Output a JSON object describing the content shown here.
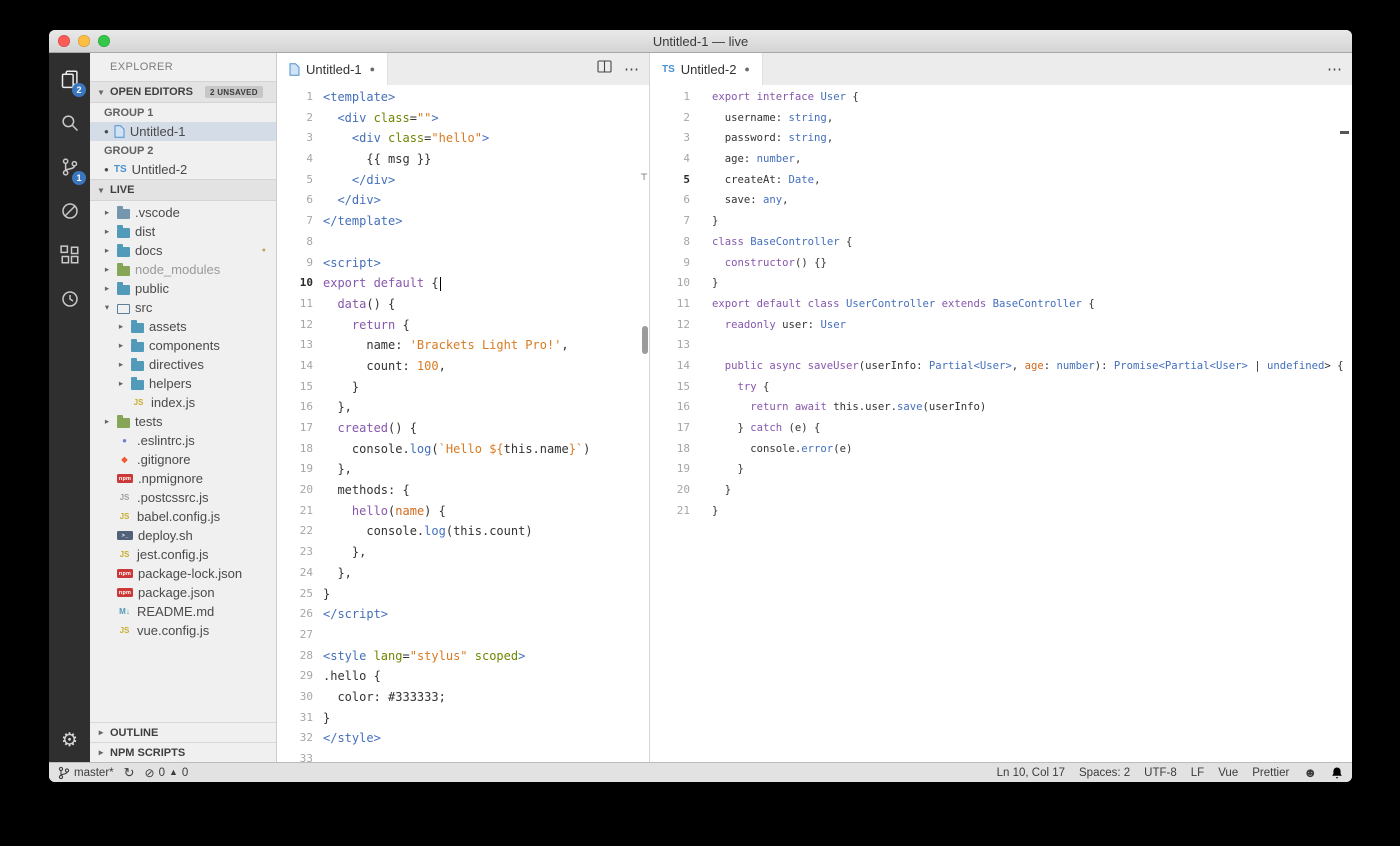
{
  "window": {
    "title": "Untitled-1 — live"
  },
  "colors": {
    "keyword": "#8757ad",
    "type": "#446fbd",
    "string": "#d97a20",
    "number": "#d97a20",
    "attribute": "#6d8600",
    "function": "#8757ad",
    "parameter": "#d2691e",
    "text": "#333333",
    "badge_blue": "#3b76c1",
    "tab_dirty": "#6a6a6a"
  },
  "activity_bar": {
    "explorer_badge": "2",
    "scm_badge": "1"
  },
  "sidebar": {
    "title": "EXPLORER",
    "open_editors": {
      "label": "OPEN EDITORS",
      "badge": "2 UNSAVED",
      "groups": [
        {
          "label": "GROUP 1",
          "files": [
            {
              "name": "Untitled-1"
            }
          ]
        },
        {
          "label": "GROUP 2",
          "files": [
            {
              "name": "Untitled-2",
              "icon_text": "TS"
            }
          ]
        }
      ]
    },
    "project_label": "LIVE",
    "tree": [
      {
        "label": ".vscode",
        "depth": 1,
        "chevron": "closed",
        "icon": {
          "kind": "folder",
          "color": "#7596ad",
          "name": "folder-icon"
        }
      },
      {
        "label": "dist",
        "depth": 1,
        "chevron": "closed",
        "icon": {
          "kind": "folder",
          "color": "#519aba",
          "name": "folder-icon"
        }
      },
      {
        "label": "docs",
        "depth": 1,
        "chevron": "closed",
        "dot": "#c5a05c",
        "icon": {
          "kind": "folder",
          "color": "#519aba",
          "name": "folder-icon"
        }
      },
      {
        "label": "node_modules",
        "depth": 1,
        "chevron": "closed",
        "muted": true,
        "icon": {
          "kind": "folder",
          "color": "#87a556",
          "name": "folder-icon"
        }
      },
      {
        "label": "public",
        "depth": 1,
        "chevron": "closed",
        "icon": {
          "kind": "folder",
          "color": "#519aba",
          "name": "folder-icon"
        }
      },
      {
        "label": "src",
        "depth": 1,
        "chevron": "open",
        "icon": {
          "kind": "folder-open",
          "color": "#5b7e9b",
          "name": "folder-open-icon"
        }
      },
      {
        "label": "assets",
        "depth": 2,
        "chevron": "closed",
        "icon": {
          "kind": "folder",
          "color": "#519aba",
          "name": "folder-icon"
        }
      },
      {
        "label": "components",
        "depth": 2,
        "chevron": "closed",
        "icon": {
          "kind": "folder",
          "color": "#519aba",
          "name": "folder-icon"
        }
      },
      {
        "label": "directives",
        "depth": 2,
        "chevron": "closed",
        "icon": {
          "kind": "folder",
          "color": "#519aba",
          "name": "folder-icon"
        }
      },
      {
        "label": "helpers",
        "depth": 2,
        "chevron": "closed",
        "icon": {
          "kind": "folder",
          "color": "#519aba",
          "name": "folder-icon"
        }
      },
      {
        "label": "index.js",
        "depth": 2,
        "icon": {
          "kind": "glyph",
          "text": "JS",
          "color": "#c9ac2e",
          "name": "js-icon"
        }
      },
      {
        "label": "tests",
        "depth": 1,
        "chevron": "closed",
        "icon": {
          "kind": "folder",
          "color": "#87a556",
          "name": "folder-icon"
        }
      },
      {
        "label": ".eslintrc.js",
        "depth": 1,
        "icon": {
          "kind": "glyph",
          "text": "●",
          "color": "#6f7ccf",
          "name": "eslint-icon"
        }
      },
      {
        "label": ".gitignore",
        "depth": 1,
        "icon": {
          "kind": "glyph",
          "text": "◆",
          "color": "#ee5b32",
          "name": "git-icon"
        }
      },
      {
        "label": ".npmignore",
        "depth": 1,
        "icon": {
          "kind": "pill",
          "text": "npm",
          "color": "#cb3837",
          "name": "npm-icon"
        }
      },
      {
        "label": ".postcssrc.js",
        "depth": 1,
        "icon": {
          "kind": "glyph",
          "text": "JS",
          "color": "#a0a0a0",
          "name": "postcss-icon"
        }
      },
      {
        "label": "babel.config.js",
        "depth": 1,
        "icon": {
          "kind": "glyph",
          "text": "JS",
          "color": "#c9ac2e",
          "name": "js-icon"
        }
      },
      {
        "label": "deploy.sh",
        "depth": 1,
        "icon": {
          "kind": "pill",
          "text": ">_",
          "color": "#51617a",
          "name": "shell-icon"
        }
      },
      {
        "label": "jest.config.js",
        "depth": 1,
        "icon": {
          "kind": "glyph",
          "text": "JS",
          "color": "#c9ac2e",
          "name": "js-icon"
        }
      },
      {
        "label": "package-lock.json",
        "depth": 1,
        "icon": {
          "kind": "pill",
          "text": "npm",
          "color": "#cb3837",
          "name": "npm-icon"
        }
      },
      {
        "label": "package.json",
        "depth": 1,
        "icon": {
          "kind": "pill",
          "text": "npm",
          "color": "#cb3837",
          "name": "npm-icon"
        }
      },
      {
        "label": "README.md",
        "depth": 1,
        "icon": {
          "kind": "glyph",
          "text": "M↓",
          "color": "#519aba",
          "name": "markdown-icon"
        }
      },
      {
        "label": "vue.config.js",
        "depth": 1,
        "icon": {
          "kind": "glyph",
          "text": "JS",
          "color": "#c9ac2e",
          "name": "js-icon"
        }
      }
    ],
    "bottom_sections": [
      "OUTLINE",
      "NPM SCRIPTS"
    ]
  },
  "editors": [
    {
      "tab": {
        "label": "Untitled-1"
      },
      "active_line": 10,
      "cursor": 10,
      "lines": [
        [
          [
            "t",
            "<template>"
          ]
        ],
        [
          [
            "d",
            "  "
          ],
          [
            "t",
            "<div "
          ],
          [
            "a",
            "class"
          ],
          [
            "d",
            "="
          ],
          [
            "s",
            "\"\""
          ],
          [
            "t",
            ">"
          ]
        ],
        [
          [
            "d",
            "    "
          ],
          [
            "t",
            "<div "
          ],
          [
            "a",
            "class"
          ],
          [
            "d",
            "="
          ],
          [
            "s",
            "\"hello\""
          ],
          [
            "t",
            ">"
          ]
        ],
        [
          [
            "d",
            "      {{ msg }}"
          ]
        ],
        [
          [
            "d",
            "    "
          ],
          [
            "t",
            "</div>"
          ]
        ],
        [
          [
            "d",
            "  "
          ],
          [
            "t",
            "</div>"
          ]
        ],
        [
          [
            "t",
            "</template>"
          ]
        ],
        [],
        [
          [
            "t",
            "<script>"
          ]
        ],
        [
          [
            "k",
            "export default"
          ],
          [
            "d",
            " {"
          ]
        ],
        [
          [
            "d",
            "  "
          ],
          [
            "f",
            "data"
          ],
          [
            "d",
            "() {"
          ]
        ],
        [
          [
            "d",
            "    "
          ],
          [
            "k",
            "return"
          ],
          [
            "d",
            " {"
          ]
        ],
        [
          [
            "d",
            "      name: "
          ],
          [
            "s",
            "'Brackets Light Pro!'"
          ],
          [
            "d",
            ","
          ]
        ],
        [
          [
            "d",
            "      count: "
          ],
          [
            "n",
            "100"
          ],
          [
            "d",
            ","
          ]
        ],
        [
          [
            "d",
            "    }"
          ]
        ],
        [
          [
            "d",
            "  },"
          ]
        ],
        [
          [
            "d",
            "  "
          ],
          [
            "f",
            "created"
          ],
          [
            "d",
            "() {"
          ]
        ],
        [
          [
            "d",
            "    console."
          ],
          [
            "t",
            "log"
          ],
          [
            "d",
            "("
          ],
          [
            "s",
            "`Hello ${"
          ],
          [
            "d",
            "this.name"
          ],
          [
            "s",
            "}`"
          ],
          [
            "d",
            ")"
          ]
        ],
        [
          [
            "d",
            "  },"
          ]
        ],
        [
          [
            "d",
            "  methods: {"
          ]
        ],
        [
          [
            "d",
            "    "
          ],
          [
            "f",
            "hello"
          ],
          [
            "d",
            "("
          ],
          [
            "o",
            "name"
          ],
          [
            "d",
            ") {"
          ]
        ],
        [
          [
            "d",
            "      console."
          ],
          [
            "t",
            "log"
          ],
          [
            "d",
            "(this.count)"
          ]
        ],
        [
          [
            "d",
            "    },"
          ]
        ],
        [
          [
            "d",
            "  },"
          ]
        ],
        [
          [
            "d",
            "}"
          ]
        ],
        [
          [
            "t",
            "</script>"
          ]
        ],
        [],
        [
          [
            "t",
            "<style "
          ],
          [
            "a",
            "lang"
          ],
          [
            "d",
            "="
          ],
          [
            "s",
            "\"stylus\""
          ],
          [
            "d",
            " "
          ],
          [
            "a",
            "scoped"
          ],
          [
            "t",
            ">"
          ]
        ],
        [
          [
            "d",
            ".hello {"
          ]
        ],
        [
          [
            "d",
            "  color: #333333;"
          ]
        ],
        [
          [
            "d",
            "}"
          ]
        ],
        [
          [
            "t",
            "</style>"
          ]
        ],
        []
      ]
    },
    {
      "tab": {
        "label": "Untitled-2",
        "icon_text": "TS"
      },
      "active_line": 5,
      "lines": [
        [
          [
            "k",
            "export interface "
          ],
          [
            "t",
            "User"
          ],
          [
            "d",
            " {"
          ]
        ],
        [
          [
            "d",
            "  username: "
          ],
          [
            "t",
            "string"
          ],
          [
            "d",
            ","
          ]
        ],
        [
          [
            "d",
            "  password: "
          ],
          [
            "t",
            "string"
          ],
          [
            "d",
            ","
          ]
        ],
        [
          [
            "d",
            "  age: "
          ],
          [
            "t",
            "number"
          ],
          [
            "d",
            ","
          ]
        ],
        [
          [
            "d",
            "  createAt: "
          ],
          [
            "t",
            "Date"
          ],
          [
            "d",
            ","
          ]
        ],
        [
          [
            "d",
            "  save: "
          ],
          [
            "t",
            "any"
          ],
          [
            "d",
            ","
          ]
        ],
        [
          [
            "d",
            "}"
          ]
        ],
        [
          [
            "k",
            "class "
          ],
          [
            "t",
            "BaseController"
          ],
          [
            "d",
            " {"
          ]
        ],
        [
          [
            "d",
            "  "
          ],
          [
            "f",
            "constructor"
          ],
          [
            "d",
            "() {}"
          ]
        ],
        [
          [
            "d",
            "}"
          ]
        ],
        [
          [
            "k",
            "export default class "
          ],
          [
            "t",
            "UserController"
          ],
          [
            "k",
            " extends "
          ],
          [
            "t",
            "BaseController"
          ],
          [
            "d",
            " {"
          ]
        ],
        [
          [
            "k",
            "  readonly"
          ],
          [
            "d",
            " user: "
          ],
          [
            "t",
            "User"
          ]
        ],
        [],
        [
          [
            "k",
            "  public async "
          ],
          [
            "f",
            "saveUser"
          ],
          [
            "d",
            "(userInfo: "
          ],
          [
            "t",
            "Partial<User>"
          ],
          [
            "d",
            ", "
          ],
          [
            "o",
            "age"
          ],
          [
            "d",
            ": "
          ],
          [
            "t",
            "number"
          ],
          [
            "d",
            "): "
          ],
          [
            "t",
            "Promise<Partial<User>"
          ],
          [
            "d",
            " | "
          ],
          [
            "t",
            "undefined"
          ],
          [
            "d",
            "> {"
          ]
        ],
        [
          [
            "d",
            "    "
          ],
          [
            "k",
            "try"
          ],
          [
            "d",
            " {"
          ]
        ],
        [
          [
            "d",
            "      "
          ],
          [
            "k",
            "return await "
          ],
          [
            "d",
            "this.user."
          ],
          [
            "t",
            "save"
          ],
          [
            "d",
            "(userInfo)"
          ]
        ],
        [
          [
            "d",
            "    } "
          ],
          [
            "k",
            "catch"
          ],
          [
            "d",
            " (e) {"
          ]
        ],
        [
          [
            "d",
            "      console."
          ],
          [
            "t",
            "error"
          ],
          [
            "d",
            "(e)"
          ]
        ],
        [
          [
            "d",
            "    }"
          ]
        ],
        [
          [
            "d",
            "  }"
          ]
        ],
        [
          [
            "d",
            "}"
          ]
        ]
      ]
    }
  ],
  "status_bar": {
    "branch": "master*",
    "errors": "0",
    "warnings": "0",
    "line_col": "Ln 10, Col 17",
    "spaces": "Spaces: 2",
    "encoding": "UTF-8",
    "eol": "LF",
    "language": "Vue",
    "formatter": "Prettier"
  }
}
